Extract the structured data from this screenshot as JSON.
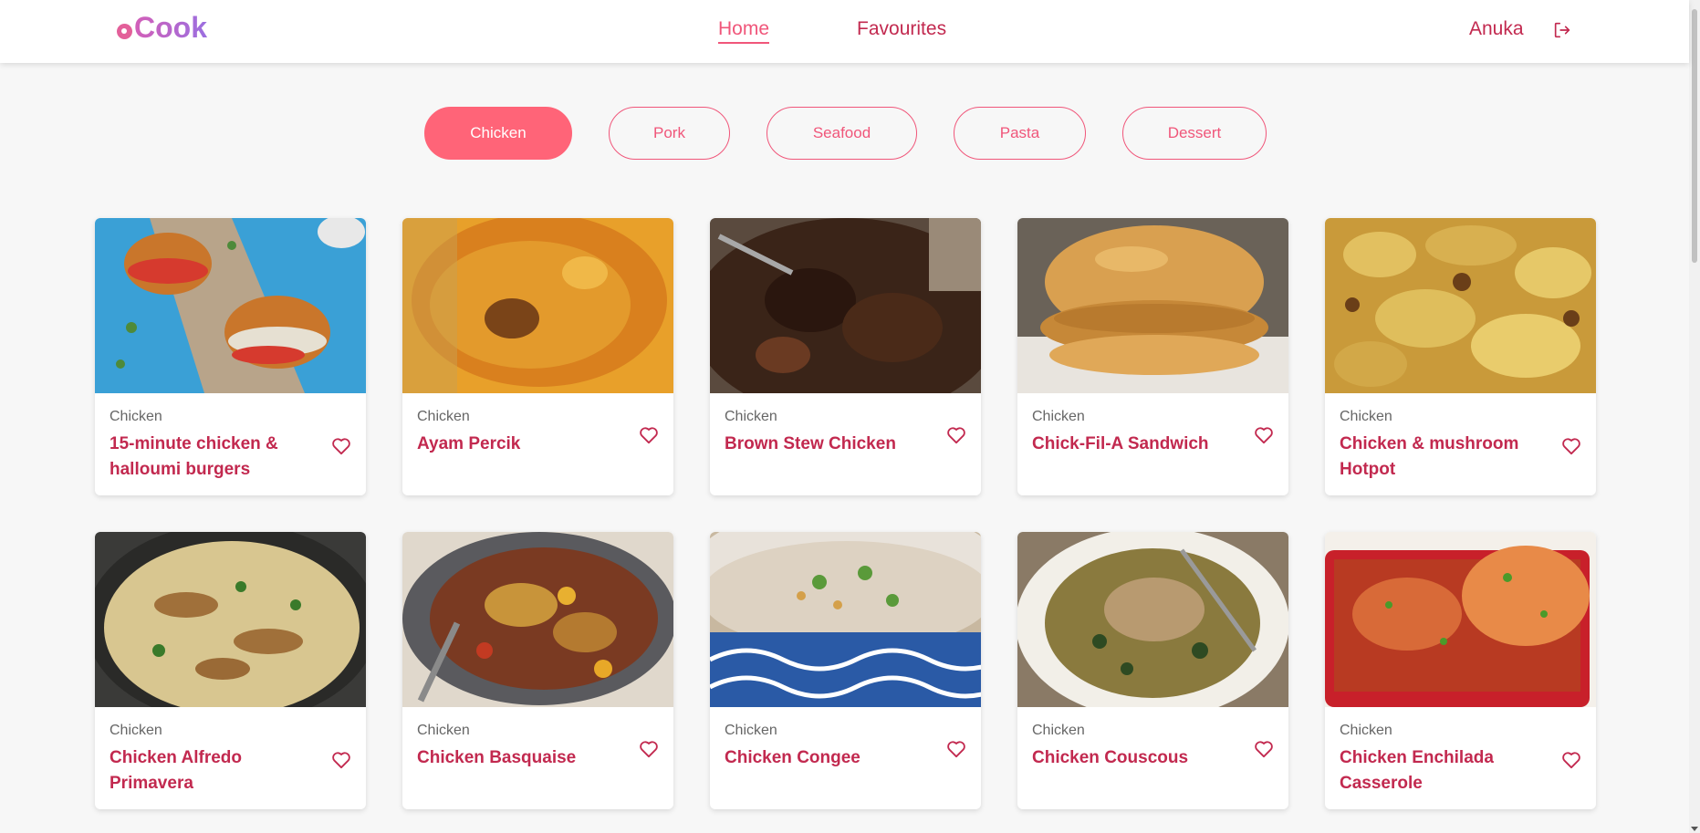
{
  "app": {
    "logo_text": "Cook"
  },
  "nav": {
    "home": "Home",
    "favourites": "Favourites"
  },
  "user": {
    "name": "Anuka"
  },
  "filters": [
    "Chicken",
    "Pork",
    "Seafood",
    "Pasta",
    "Dessert"
  ],
  "colors": {
    "accent": "#f0567a",
    "title": "#c2294f",
    "chip_active": "#ff6478"
  },
  "recipes": [
    {
      "category": "Chicken",
      "title": "15-minute chicken & halloumi burgers"
    },
    {
      "category": "Chicken",
      "title": "Ayam Percik"
    },
    {
      "category": "Chicken",
      "title": "Brown Stew Chicken"
    },
    {
      "category": "Chicken",
      "title": "Chick-Fil-A Sandwich"
    },
    {
      "category": "Chicken",
      "title": "Chicken & mushroom Hotpot"
    },
    {
      "category": "Chicken",
      "title": "Chicken Alfredo Primavera"
    },
    {
      "category": "Chicken",
      "title": "Chicken Basquaise"
    },
    {
      "category": "Chicken",
      "title": "Chicken Congee"
    },
    {
      "category": "Chicken",
      "title": "Chicken Couscous"
    },
    {
      "category": "Chicken",
      "title": "Chicken Enchilada Casserole"
    }
  ]
}
